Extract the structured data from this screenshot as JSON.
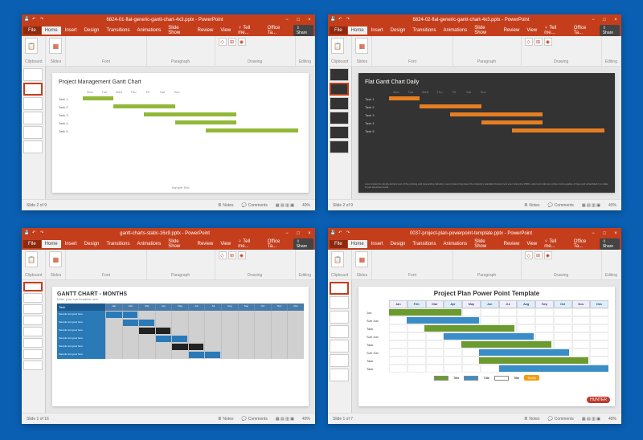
{
  "windows": [
    {
      "title": "6824-01-flat-generic-gantt-chart-4x3.pptx - PowerPoint",
      "status_slide": "Slide 2 of 9",
      "status_zoom": "40%",
      "slide": {
        "title": "Project Management Gantt Chart",
        "footer": "Sample Text",
        "days": [
          "Mon",
          "Tue",
          "Wed",
          "Thu",
          "Fri",
          "Sat",
          "Sun"
        ],
        "tasks": [
          "Task 1",
          "Task 2",
          "Task 3",
          "Task 4",
          "Task 5"
        ]
      }
    },
    {
      "title": "6824-02-flat-generic-gantt-chart-4x3.pptx - PowerPoint",
      "status_slide": "Slide 2 of 9",
      "status_zoom": "40%",
      "slide": {
        "title": "Flat Gantt Chart Daily",
        "footer": "Lorem Ipsum is simply dummy text of the printing and typesetting industry. Lorem Ipsum has been the industry's standard dummy text ever since the 1500s, when an unknown printer took a galley of type and scrambled it to make a type specimen book.",
        "days": [
          "Mon",
          "Tue",
          "Wed",
          "Thu",
          "Fri",
          "Sat",
          "Sun"
        ],
        "tasks": [
          "Task 1",
          "Task 2",
          "Task 3",
          "Task 4",
          "Task 5"
        ]
      }
    },
    {
      "title": "gantt-charts-static-16x9.pptx - PowerPoint",
      "status_slide": "Slide 1 of 16",
      "status_zoom": "40%",
      "slide": {
        "title": "GANTT CHART - MONTHS",
        "subtitle": "Enter your sub headline here",
        "task_header": "Task",
        "months": [
          "Jan",
          "Feb",
          "Mar",
          "Apr",
          "May",
          "Jun",
          "Jul",
          "Aug",
          "Sep",
          "Oct",
          "Nov",
          "Dec"
        ],
        "row_label": "Sample text goes here"
      }
    },
    {
      "title": "0037-project-plan-powerpoint-template.pptx - PowerPoint",
      "status_slide": "Slide 1 of 7",
      "status_zoom": "40%",
      "slide": {
        "title": "Project Plan Power Point Template",
        "months": [
          "Jan",
          "Feb",
          "Mar",
          "Apr",
          "May",
          "Jun",
          "Jul",
          "Aug",
          "Sep",
          "Oct",
          "Nov",
          "Dec"
        ],
        "rows": [
          "Job",
          "Sub Job",
          "Task",
          "Sub Job",
          "Task",
          "Sub Job",
          "Task",
          "Task"
        ],
        "legend": [
          "Title",
          "Title",
          "Title"
        ],
        "today": "Today",
        "logo": "HUNTER"
      }
    }
  ],
  "menu": {
    "file": "File",
    "home": "Home",
    "insert": "Insert",
    "design": "Design",
    "transitions": "Transitions",
    "animations": "Animations",
    "slideshow": "Slide Show",
    "review": "Review",
    "view": "View",
    "tellme": "♀ Tell me...",
    "officetab": "Office Ta...",
    "share": "⇪ Share"
  },
  "ribbon": {
    "clipboard": "Clipboard",
    "paste": "Paste",
    "newslide": "New\nSlide",
    "slides": "Slides",
    "font": "Font",
    "paragraph": "Paragraph",
    "shapes": "Shapes",
    "arrange": "Arrange",
    "quickstyles": "Quick\nStyles",
    "drawing": "Drawing",
    "editing": "Editing"
  },
  "status": {
    "notes": "Notes",
    "comments": "Comments"
  },
  "chart_data": [
    {
      "type": "bar",
      "title": "Project Management Gantt Chart",
      "categories": [
        "Mon",
        "Tue",
        "Wed",
        "Thu",
        "Fri",
        "Sat",
        "Sun"
      ],
      "series": [
        {
          "name": "Task 1",
          "start": 0,
          "end": 1
        },
        {
          "name": "Task 2",
          "start": 1,
          "end": 3
        },
        {
          "name": "Task 3",
          "start": 2,
          "end": 5
        },
        {
          "name": "Task 4",
          "start": 3,
          "end": 5
        },
        {
          "name": "Task 5",
          "start": 4,
          "end": 7
        }
      ]
    },
    {
      "type": "bar",
      "title": "Flat Gantt Chart Daily",
      "categories": [
        "Mon",
        "Tue",
        "Wed",
        "Thu",
        "Fri",
        "Sat",
        "Sun"
      ],
      "series": [
        {
          "name": "Task 1",
          "start": 0,
          "end": 1
        },
        {
          "name": "Task 2",
          "start": 1,
          "end": 3
        },
        {
          "name": "Task 3",
          "start": 2,
          "end": 5
        },
        {
          "name": "Task 4",
          "start": 3,
          "end": 5
        },
        {
          "name": "Task 5",
          "start": 4,
          "end": 7
        }
      ]
    },
    {
      "type": "bar",
      "title": "GANTT CHART - MONTHS",
      "categories": [
        "Jan",
        "Feb",
        "Mar",
        "Apr",
        "May",
        "Jun",
        "Jul",
        "Aug",
        "Sep",
        "Oct",
        "Nov",
        "Dec"
      ],
      "series": [
        {
          "name": "Sample text goes here",
          "start": 0,
          "end": 2
        },
        {
          "name": "Sample text goes here",
          "start": 1,
          "end": 3
        },
        {
          "name": "Sample text goes here",
          "start": 2,
          "end": 4
        },
        {
          "name": "Sample text goes here",
          "start": 3,
          "end": 5
        },
        {
          "name": "Sample text goes here",
          "start": 4,
          "end": 6
        },
        {
          "name": "Sample text goes here",
          "start": 5,
          "end": 7
        }
      ]
    },
    {
      "type": "bar",
      "title": "Project Plan Power Point Template",
      "categories": [
        "Jan",
        "Feb",
        "Mar",
        "Apr",
        "May",
        "Jun",
        "Jul",
        "Aug",
        "Sep",
        "Oct",
        "Nov",
        "Dec"
      ],
      "series": [
        {
          "name": "Job",
          "start": 0,
          "end": 4
        },
        {
          "name": "Sub Job",
          "start": 1,
          "end": 5
        },
        {
          "name": "Task",
          "start": 2,
          "end": 7
        },
        {
          "name": "Sub Job",
          "start": 3,
          "end": 8
        },
        {
          "name": "Task",
          "start": 4,
          "end": 9
        },
        {
          "name": "Sub Job",
          "start": 5,
          "end": 10
        },
        {
          "name": "Task",
          "start": 5,
          "end": 11
        },
        {
          "name": "Task",
          "start": 6,
          "end": 12
        }
      ]
    }
  ]
}
